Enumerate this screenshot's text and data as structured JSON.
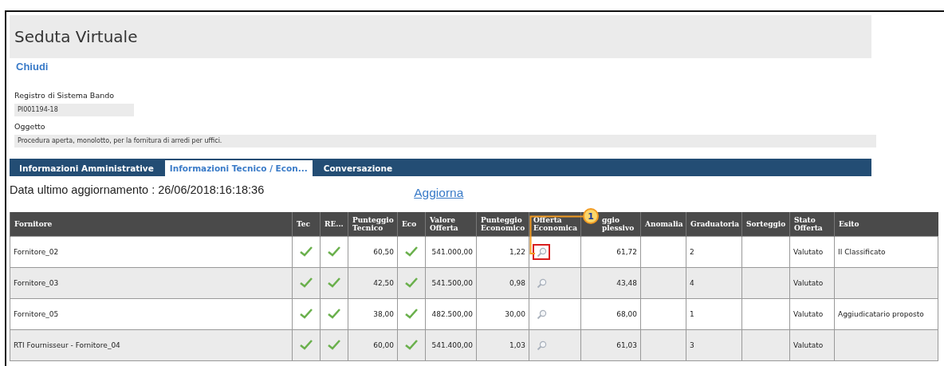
{
  "page": {
    "title": "Seduta Virtuale",
    "close_link": "Chiudi"
  },
  "fields": [
    {
      "label": "Registro di Sistema Bando",
      "value": "PI001194-18",
      "kind": "short"
    },
    {
      "label": "Oggetto",
      "value": "Procedura aperta, monolotto, per la fornitura di arredi per uffici.",
      "kind": "wide"
    }
  ],
  "tabs": [
    {
      "label": "Informazioni Amministrative",
      "selected": false
    },
    {
      "label": "Informazioni Tecnico / Econ...",
      "selected": true
    },
    {
      "label": "Conversazione",
      "selected": false
    }
  ],
  "update": {
    "text": "Data ultimo aggiornamento : 26/06/2018:16:18:36",
    "refresh_link": "Aggiorna"
  },
  "table": {
    "columns": [
      {
        "lines": [
          "Fornitore"
        ],
        "kind": "text"
      },
      {
        "lines": [
          "Tec"
        ],
        "kind": "check"
      },
      {
        "lines": [
          "RE..."
        ],
        "kind": "check"
      },
      {
        "lines": [
          "Punteggio",
          "Tecnico"
        ],
        "kind": "number"
      },
      {
        "lines": [
          "Eco"
        ],
        "kind": "check"
      },
      {
        "lines": [
          "Valore",
          "Offerta"
        ],
        "kind": "number"
      },
      {
        "lines": [
          "Punteggio",
          "Economico"
        ],
        "kind": "number"
      },
      {
        "lines": [
          "Offerta",
          "Economica"
        ],
        "kind": "view"
      },
      {
        "lines": [
          "ggio",
          "plessivo"
        ],
        "kind": "number"
      },
      {
        "lines": [
          "Anomalia"
        ],
        "kind": "text"
      },
      {
        "lines": [
          "Graduatoria"
        ],
        "kind": "text"
      },
      {
        "lines": [
          "Sorteggio"
        ],
        "kind": "text"
      },
      {
        "lines": [
          "Stato",
          "Offerta"
        ],
        "kind": "text"
      },
      {
        "lines": [
          "Esito"
        ],
        "kind": "text"
      }
    ],
    "rows": [
      {
        "cells": [
          {
            "text": "Fornitore_02"
          },
          {
            "checked": true
          },
          {
            "checked": true
          },
          {
            "text": "60,50"
          },
          {
            "checked": true
          },
          {
            "text": "541.000,00"
          },
          {
            "text": "1,22"
          },
          {
            "highlighted": true
          },
          {
            "text": "61,72"
          },
          {
            "text": ""
          },
          {
            "text": "2"
          },
          {
            "text": ""
          },
          {
            "text": "Valutato"
          },
          {
            "text": "II Classificato"
          }
        ]
      },
      {
        "cells": [
          {
            "text": "Fornitore_03"
          },
          {
            "checked": true
          },
          {
            "checked": true
          },
          {
            "text": "42,50"
          },
          {
            "checked": true
          },
          {
            "text": "541.500,00"
          },
          {
            "text": "0,98"
          },
          {
            "highlighted": false
          },
          {
            "text": "43,48"
          },
          {
            "text": ""
          },
          {
            "text": "4"
          },
          {
            "text": ""
          },
          {
            "text": "Valutato"
          },
          {
            "text": ""
          }
        ]
      },
      {
        "cells": [
          {
            "text": "Fornitore_05"
          },
          {
            "checked": true
          },
          {
            "checked": true
          },
          {
            "text": "38,00"
          },
          {
            "checked": true
          },
          {
            "text": "482.500,00"
          },
          {
            "text": "30,00"
          },
          {
            "highlighted": false
          },
          {
            "text": "68,00"
          },
          {
            "text": ""
          },
          {
            "text": "1"
          },
          {
            "text": ""
          },
          {
            "text": "Valutato"
          },
          {
            "text": "Aggiudicatario proposto"
          }
        ]
      },
      {
        "cells": [
          {
            "text": "RTI Fournisseur - Fornitore_04"
          },
          {
            "checked": true
          },
          {
            "checked": true
          },
          {
            "text": "60,00"
          },
          {
            "checked": true
          },
          {
            "text": "541.400,00"
          },
          {
            "text": "1,03"
          },
          {
            "highlighted": false
          },
          {
            "text": "61,03"
          },
          {
            "text": ""
          },
          {
            "text": "3"
          },
          {
            "text": ""
          },
          {
            "text": "Valutato"
          },
          {
            "text": ""
          }
        ]
      }
    ]
  },
  "callout": {
    "number": "1"
  }
}
